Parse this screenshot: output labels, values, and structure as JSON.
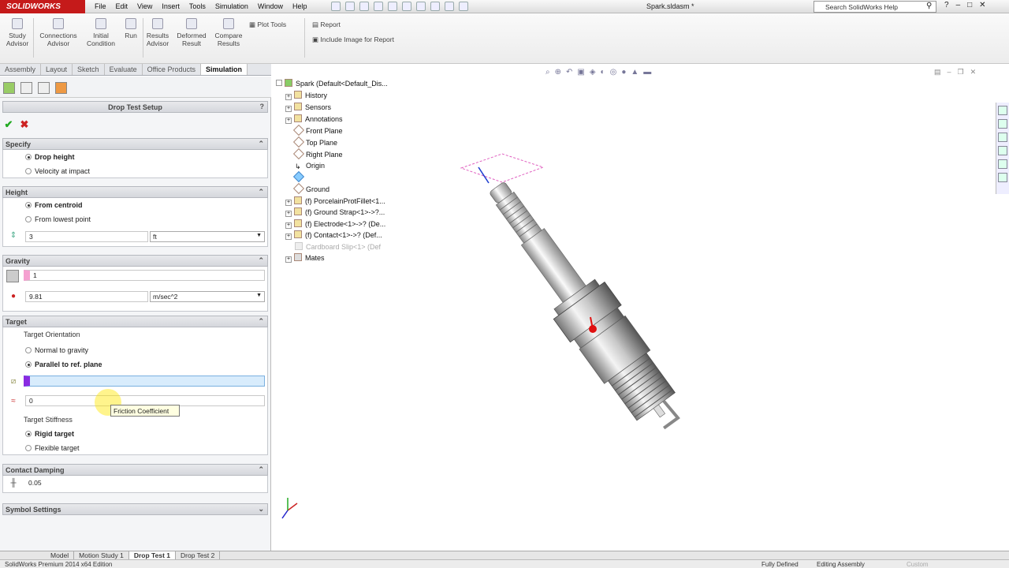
{
  "app": {
    "logo": "SOLIDWORKS",
    "doc_title": "Spark.sldasm *",
    "search_placeholder": "Search SolidWorks Help"
  },
  "menu": [
    "File",
    "Edit",
    "View",
    "Insert",
    "Tools",
    "Simulation",
    "Window",
    "Help"
  ],
  "ribbon": {
    "study_advisor": [
      "Study",
      "Advisor"
    ],
    "connections_advisor": [
      "Connections",
      "Advisor"
    ],
    "initial_condition": [
      "Initial",
      "Condition"
    ],
    "run": "Run",
    "results_advisor": [
      "Results",
      "Advisor"
    ],
    "deformed_result": [
      "Deformed",
      "Result"
    ],
    "compare_results": [
      "Compare",
      "Results"
    ],
    "plot_tools": "Plot Tools",
    "report": "Report",
    "include_image": "Include Image for Report"
  },
  "tabs": [
    "Assembly",
    "Layout",
    "Sketch",
    "Evaluate",
    "Office Products",
    "Simulation"
  ],
  "active_tab": "Simulation",
  "panel": {
    "title": "Drop Test Setup",
    "help": "?",
    "specify": {
      "header": "Specify",
      "opt1": "Drop height",
      "opt2": "Velocity at impact"
    },
    "height": {
      "header": "Height",
      "opt1": "From centroid",
      "opt2": "From lowest point",
      "value": "3",
      "unit": "ft"
    },
    "gravity": {
      "header": "Gravity",
      "ref": "1",
      "value": "9.81",
      "unit": "m/sec^2"
    },
    "target": {
      "header": "Target",
      "orientation_label": "Target Orientation",
      "opt1": "Normal to gravity",
      "opt2": "Parallel to ref. plane",
      "friction": "0",
      "stiffness_label": "Target Stiffness",
      "stiff1": "Rigid target",
      "stiff2": "Flexible target"
    },
    "contact": {
      "header": "Contact Damping",
      "value": "0.05"
    },
    "symbol": {
      "header": "Symbol Settings"
    },
    "tooltip": "Friction Coefficient"
  },
  "tree": [
    {
      "label": "Spark  (Default<Default_Dis...",
      "expander": "",
      "dim": false
    },
    {
      "label": "History",
      "expander": "+",
      "dim": false
    },
    {
      "label": "Sensors",
      "expander": "+",
      "dim": false
    },
    {
      "label": "Annotations",
      "expander": "+",
      "dim": false
    },
    {
      "label": "Front Plane",
      "expander": "",
      "dim": false
    },
    {
      "label": "Top Plane",
      "expander": "",
      "dim": false
    },
    {
      "label": "Right Plane",
      "expander": "",
      "dim": false
    },
    {
      "label": "Origin",
      "expander": "",
      "dim": false
    },
    {
      "label": "",
      "expander": "",
      "dim": false
    },
    {
      "label": "Ground",
      "expander": "",
      "dim": false
    },
    {
      "label": "(f) PorcelainProtFillet<1...",
      "expander": "+",
      "dim": false
    },
    {
      "label": "(f) Ground Strap<1>->?...",
      "expander": "+",
      "dim": false
    },
    {
      "label": "(f) Electrode<1>->? (De...",
      "expander": "+",
      "dim": false
    },
    {
      "label": "(f) Contact<1>->? (Def...",
      "expander": "+",
      "dim": false
    },
    {
      "label": "Cardboard Slip<1> (Def",
      "expander": "",
      "dim": true
    },
    {
      "label": "Mates",
      "expander": "+",
      "dim": false
    }
  ],
  "bottom_tabs": [
    "Model",
    "Motion Study 1",
    "Drop Test 1",
    "Drop Test 2"
  ],
  "active_bottom_tab": "Drop Test 1",
  "status": {
    "left": "SolidWorks Premium 2014 x64 Edition",
    "defined": "Fully Defined",
    "editing": "Editing Assembly",
    "custom": "Custom"
  }
}
